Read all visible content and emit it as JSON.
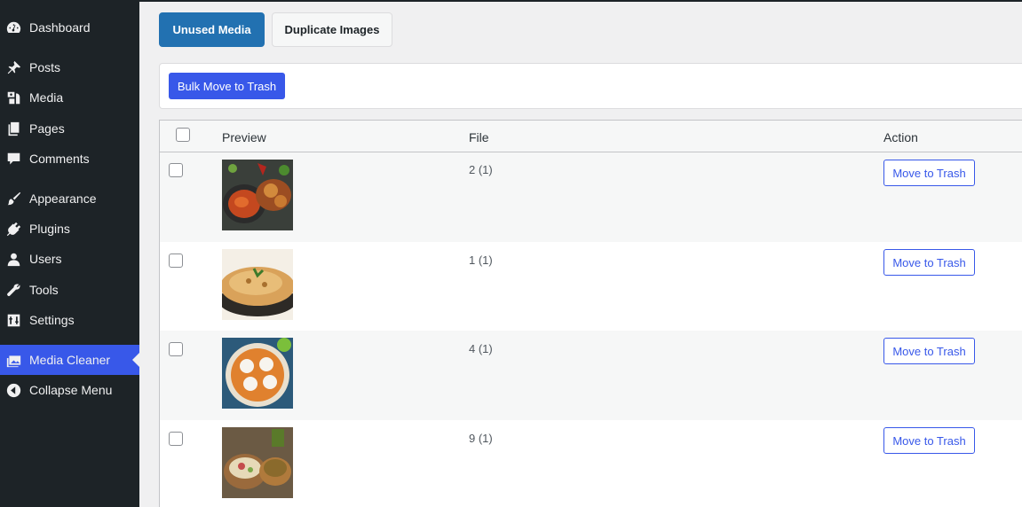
{
  "sidebar": {
    "items": [
      {
        "label": "Dashboard",
        "icon": "dashboard-icon"
      },
      {
        "label": "Posts",
        "icon": "pin-icon"
      },
      {
        "label": "Media",
        "icon": "media-icon"
      },
      {
        "label": "Pages",
        "icon": "pages-icon"
      },
      {
        "label": "Comments",
        "icon": "comments-icon"
      },
      {
        "label": "Appearance",
        "icon": "brush-icon"
      },
      {
        "label": "Plugins",
        "icon": "plugin-icon"
      },
      {
        "label": "Users",
        "icon": "users-icon"
      },
      {
        "label": "Tools",
        "icon": "wrench-icon"
      },
      {
        "label": "Settings",
        "icon": "settings-icon"
      },
      {
        "label": "Media Cleaner",
        "icon": "gallery-icon",
        "active": true
      },
      {
        "label": "Collapse Menu",
        "icon": "collapse-icon"
      }
    ]
  },
  "tabs": {
    "unused": "Unused Media",
    "duplicate": "Duplicate Images"
  },
  "bulk": {
    "label": "Bulk Move to Trash"
  },
  "table": {
    "columns": {
      "preview": "Preview",
      "file": "File",
      "action": "Action"
    },
    "rows": [
      {
        "file": "2 (1)",
        "action": "Move to Trash",
        "thumb": "food-platter-thumbnail"
      },
      {
        "file": "1 (1)",
        "action": "Move to Trash",
        "thumb": "paratha-thumbnail"
      },
      {
        "file": "4 (1)",
        "action": "Move to Trash",
        "thumb": "idli-curry-thumbnail"
      },
      {
        "file": "9 (1)",
        "action": "Move to Trash",
        "thumb": "chaat-platter-thumbnail"
      }
    ]
  },
  "colors": {
    "sidebar_bg": "#1d2327",
    "accent": "#3858e9",
    "tab_active": "#2271b1"
  }
}
